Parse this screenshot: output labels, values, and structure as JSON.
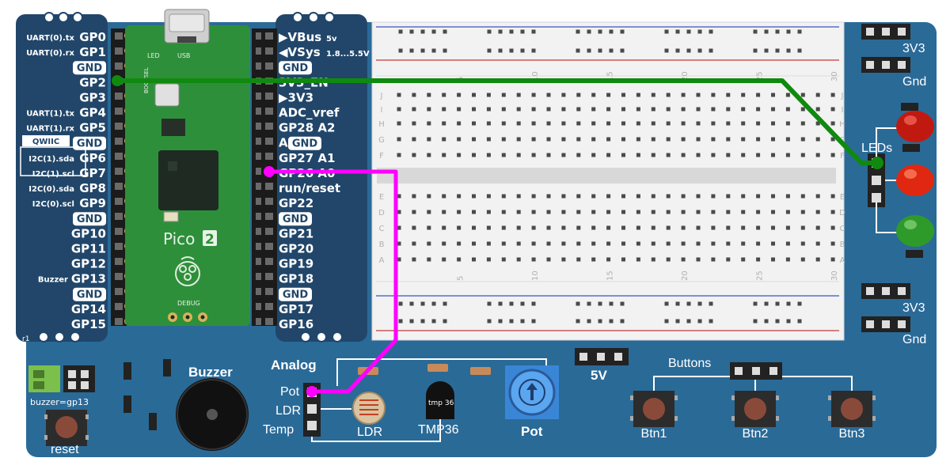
{
  "pico_left_pins": [
    {
      "name": "GP0",
      "func": "UART(0).tx"
    },
    {
      "name": "GP1",
      "func": "UART(0).rx"
    },
    {
      "name": "GND",
      "func": ""
    },
    {
      "name": "GP2",
      "func": ""
    },
    {
      "name": "GP3",
      "func": ""
    },
    {
      "name": "GP4",
      "func": "UART(1).tx"
    },
    {
      "name": "GP5",
      "func": "UART(1).rx"
    },
    {
      "name": "GND",
      "func": ""
    },
    {
      "name": "GP6",
      "func": "I2C(1).sda"
    },
    {
      "name": "GP7",
      "func": "I2C(1).scl"
    },
    {
      "name": "GP8",
      "func": "I2C(0).sda"
    },
    {
      "name": "GP9",
      "func": "I2C(0).scl"
    },
    {
      "name": "GND",
      "func": ""
    },
    {
      "name": "GP10",
      "func": ""
    },
    {
      "name": "GP11",
      "func": ""
    },
    {
      "name": "GP12",
      "func": ""
    },
    {
      "name": "GP13",
      "func": "Buzzer"
    },
    {
      "name": "GND",
      "func": ""
    },
    {
      "name": "GP14",
      "func": ""
    },
    {
      "name": "GP15",
      "func": ""
    }
  ],
  "pico_right_pins": [
    {
      "name": "▶VBus",
      "suffix": "5v"
    },
    {
      "name": "◀VSys",
      "suffix": "1.8...5.5V"
    },
    {
      "name": "GND",
      "suffix": ""
    },
    {
      "name": "3V3_EN",
      "suffix": ""
    },
    {
      "name": "▶3V3",
      "suffix": ""
    },
    {
      "name": "ADC_vref",
      "suffix": ""
    },
    {
      "name": "GP28 A2",
      "suffix": ""
    },
    {
      "name": "A",
      "suffix": "GND"
    },
    {
      "name": "GP27 A1",
      "suffix": ""
    },
    {
      "name": "GP26 A0",
      "suffix": ""
    },
    {
      "name": "run/reset",
      "suffix": ""
    },
    {
      "name": "GP22",
      "suffix": ""
    },
    {
      "name": "GND",
      "suffix": ""
    },
    {
      "name": "GP21",
      "suffix": ""
    },
    {
      "name": "GP20",
      "suffix": ""
    },
    {
      "name": "GP19",
      "suffix": ""
    },
    {
      "name": "GP18",
      "suffix": ""
    },
    {
      "name": "GND",
      "suffix": ""
    },
    {
      "name": "GP17",
      "suffix": ""
    },
    {
      "name": "GP16",
      "suffix": ""
    }
  ],
  "qwiic_label": "QWIIC",
  "pico_board": {
    "logo": "Pico",
    "logo_badge": "2",
    "led": "LED",
    "usb": "USB",
    "bootsel": "BOOTSEL",
    "debug": "DEBUG",
    "corner": "r1"
  },
  "breadboard": {
    "columns": [
      "5",
      "10",
      "15",
      "20",
      "25",
      "30"
    ],
    "rows_top": [
      "J",
      "I",
      "H",
      "G",
      "F"
    ],
    "rows_bottom": [
      "E",
      "D",
      "C",
      "B",
      "A"
    ]
  },
  "power": {
    "top_3v3": "3V3",
    "top_gnd": "Gnd",
    "bottom_3v3": "3V3",
    "bottom_gnd": "Gnd",
    "five_v": "5V"
  },
  "leds": {
    "label": "LEDs",
    "colors": [
      "#c01a10",
      "#e02810",
      "#2e9a2a"
    ]
  },
  "analog": {
    "title": "Analog",
    "inputs": [
      "Pot",
      "LDR",
      "Temp"
    ]
  },
  "components": {
    "ldr": "LDR",
    "tmp36": "TMP36",
    "tmp36_marking": "tmp 36",
    "pot": "Pot",
    "buzzer": "Buzzer",
    "buzzer_jumper": "buzzer=gp13",
    "reset": "reset"
  },
  "buttons": {
    "title": "Buttons",
    "items": [
      "Btn1",
      "Btn2",
      "Btn3"
    ]
  },
  "wires": [
    {
      "from": "GP2",
      "to": "LEDs",
      "color": "#0f8a0f"
    },
    {
      "from": "GP26 A0",
      "to": "Pot",
      "color": "#ff00ff"
    }
  ],
  "colors": {
    "board": "#2a6a97",
    "pcb": "#21466a",
    "pico_green": "#2e8f3a",
    "wire_green": "#0f8a0f",
    "wire_magenta": "#ff00ff"
  }
}
